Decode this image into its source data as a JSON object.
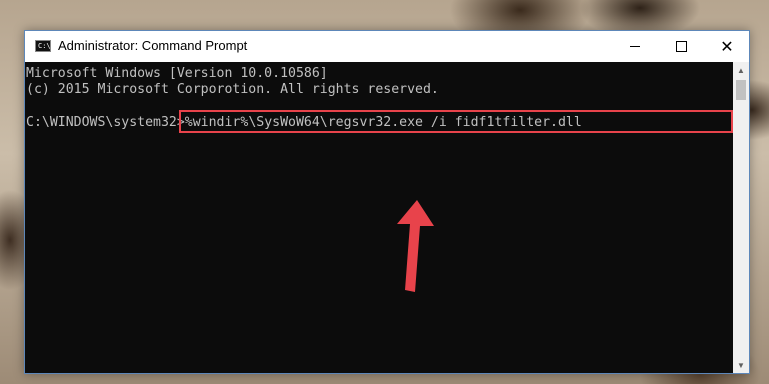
{
  "window": {
    "title": "Administrator: Command Prompt",
    "icon_label": "C:\\",
    "controls": {
      "minimize_icon": "minimize-icon",
      "maximize_icon": "maximize-icon",
      "close_glyph": "✕"
    }
  },
  "console": {
    "lines": [
      "Microsoft Windows [Version 10.0.10586]",
      "(c) 2015 Microsoft Corporotion. All rights reserved."
    ],
    "prompt": "C:\\WINDOWS\\system32>",
    "command": "%windir%\\SysWoW64\\regsvr32.exe /i fidf1tfilter.dll"
  },
  "annotation": {
    "highlight_color": "#e8434b",
    "arrow_color": "#e8434b"
  },
  "colors": {
    "console_bg": "#0c0c0c",
    "console_text": "#c0c0c0",
    "window_border": "#5d87b9"
  }
}
